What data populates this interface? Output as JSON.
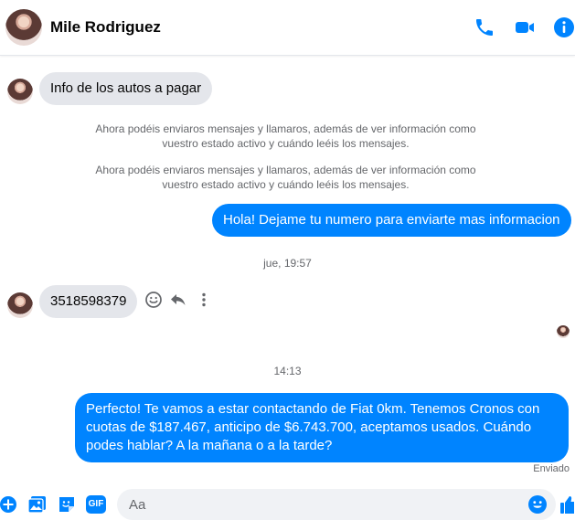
{
  "header": {
    "contact_name": "Mile Rodriguez",
    "icons": [
      "phone-icon",
      "video-camera-icon",
      "info-icon"
    ]
  },
  "colors": {
    "accent": "#0084ff",
    "incoming_bubble": "#e4e6eb",
    "muted_text": "#65676b"
  },
  "messages": {
    "m1": "Info de los autos a pagar",
    "sys1": "Ahora podéis enviaros mensajes y llamaros, además de ver información como vuestro estado activo y cuándo leéis los mensajes.",
    "sys2": "Ahora podéis enviaros mensajes y llamaros, además de ver información como vuestro estado activo y cuándo leéis los mensajes.",
    "m2": "Hola! Dejame tu numero para enviarte mas informacion",
    "stamp1": "jue, 19:57",
    "m3": "3518598379",
    "stamp2": "14:13",
    "m4": "Perfecto! Te vamos a estar contactando de Fiat 0km. Tenemos Cronos con cuotas de $187.467, anticipo de $6.743.700, aceptamos usados. Cuándo podes hablar? A la mañana o a la tarde?",
    "status": "Enviado"
  },
  "composer": {
    "placeholder": "Aa",
    "icons": [
      "add-icon",
      "photo-icon",
      "sticker-icon",
      "gif-icon",
      "emoji-icon",
      "like-icon"
    ],
    "gif_label": "GIF"
  }
}
